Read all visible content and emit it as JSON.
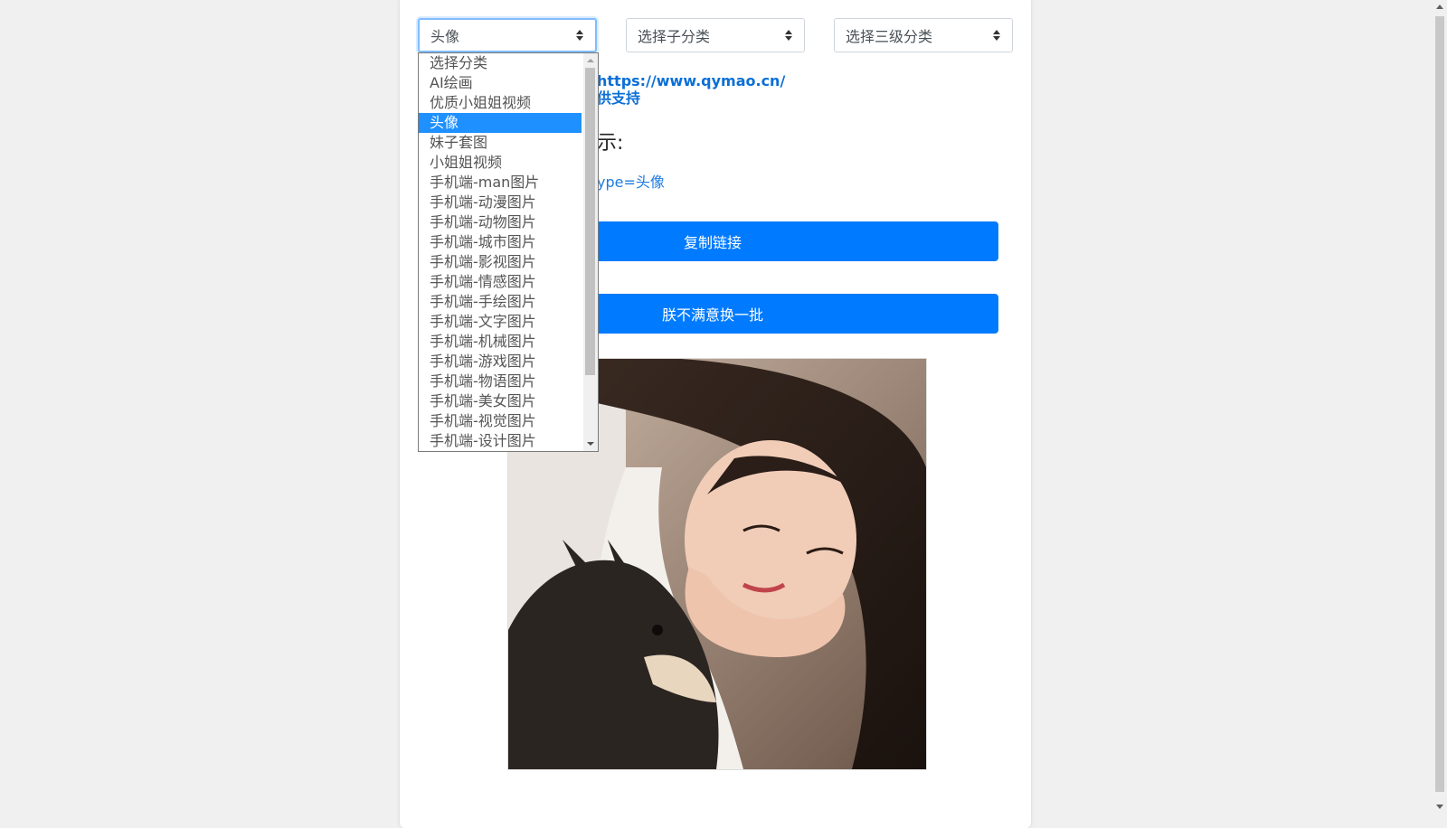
{
  "selects": {
    "category": {
      "value": "头像"
    },
    "subcategory": {
      "value": "选择子分类"
    },
    "level3": {
      "value": "选择三级分类"
    }
  },
  "dropdown": {
    "options": [
      "选择分类",
      "AI绘画",
      "优质小姐姐视频",
      "头像",
      "妹子套图",
      "小姐姐视频",
      "手机端-man图片",
      "手机端-动漫图片",
      "手机端-动物图片",
      "手机端-城市图片",
      "手机端-影视图片",
      "手机端-情感图片",
      "手机端-手绘图片",
      "手机端-文字图片",
      "手机端-机械图片",
      "手机端-游戏图片",
      "手机端-物语图片",
      "手机端-美女图片",
      "手机端-视觉图片",
      "手机端-设计图片"
    ],
    "selected_index": 3,
    "selected_color": "#1e90ff"
  },
  "info": {
    "site_url_partial": "https://www.qymao.cn/",
    "support_partial": "供支持"
  },
  "preview": {
    "heading_partial": "示:",
    "api_link_partial": "ype=头像"
  },
  "buttons": {
    "copy_link": "复制链接",
    "refresh": "朕不满意换一批"
  },
  "colors": {
    "primary": "#007bff",
    "link": "#0b6fd6",
    "page_bg": "#f0f0f0"
  }
}
